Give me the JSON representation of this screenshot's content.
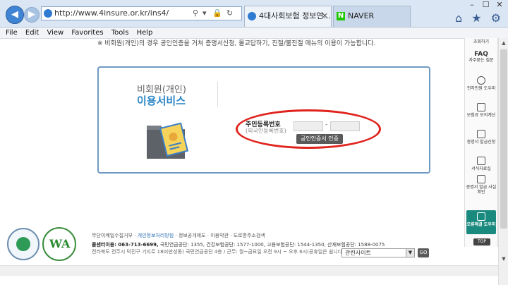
{
  "browser": {
    "url": "http://www.4insure.or.kr/ins4/",
    "tabs": [
      {
        "label": "4대사회보험 정보연..."
      },
      {
        "label": "NAVER",
        "icon_text": "N"
      }
    ],
    "menu": [
      "File",
      "Edit",
      "View",
      "Favorites",
      "Tools",
      "Help"
    ],
    "window_controls": [
      "–",
      "☐",
      "✕"
    ],
    "nav": {
      "back": "◀",
      "forward": "▶"
    },
    "address_icons": [
      "⚲",
      "▾",
      "🔒",
      "↻"
    ],
    "tool_icons": "⌂ ★ ⚙"
  },
  "notice": "※ 비회원(개인)의 경우 공인인증을 거쳐 증명서신청, 몰교답하기, 진절/불진절 메뉴의 이용이 가능합니다.",
  "service": {
    "title_line1": "비회원(개인)",
    "title_line2": "이용서비스",
    "rrn_label": "주민등록번호",
    "rrn_sub": "(외국인등록번호)",
    "dash": "-",
    "cert_button": "공인인증서 인증"
  },
  "footer": {
    "links": [
      "무단이메일수집거부",
      "개인정보처리방침",
      "정보공개제도",
      "이용약관",
      "도로명주소검색"
    ],
    "callcenter_label": "콜센터이용: 063-713-6699,",
    "callcenter_detail": "국민연금공단: 1355, 건강보험공단: 1577-1000, 고용보험공단: 1544-1350, 산재보험공단: 1588-0075",
    "address": "전라북도 전주시 덕진구 기지로 180(만성동) 국민연금공단 4층 / 근무: 월~금요일 오전 9시 ~ 오후 6시(공휴일은 쉽니다)",
    "related_sites": "관련사이트",
    "go": "GO",
    "logo2_text": "WA"
  },
  "quick_menu": {
    "items": [
      {
        "label": "조회하기"
      },
      {
        "big": "FAQ",
        "label": "자주묻는 질문"
      },
      {
        "label": "전자민원 도우미"
      },
      {
        "label": "보험료 모의계산"
      },
      {
        "label": "증명서 발급신청"
      },
      {
        "label": "서식자료실"
      },
      {
        "label": "증명서 발급 사실 확인"
      }
    ],
    "help": "오류해결 도우미",
    "top": "TOP"
  },
  "colors": {
    "accent_blue": "#2c86c8",
    "panel_border": "#6f9ac4",
    "highlight_red": "#e0241d",
    "help_green": "#1b8a7e"
  }
}
